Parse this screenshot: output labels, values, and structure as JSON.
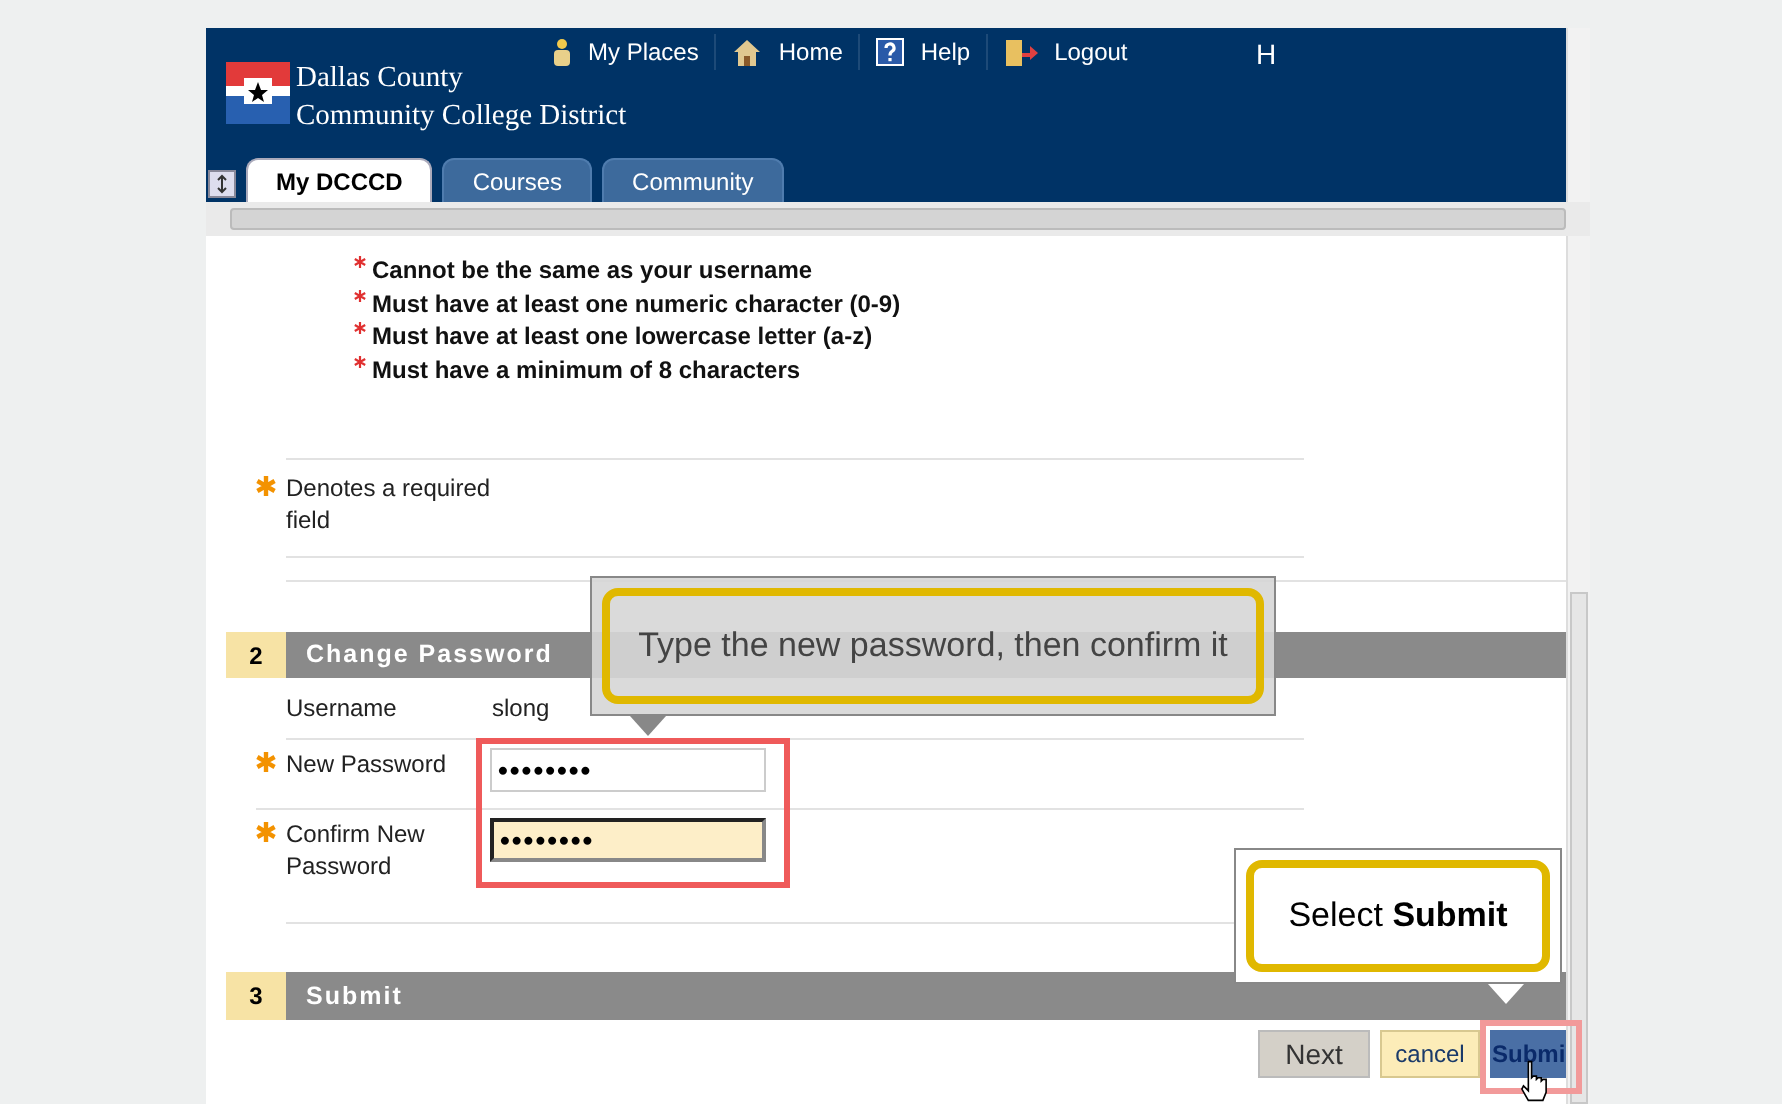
{
  "header": {
    "logo_lines": [
      "Dallas County",
      "Community College District"
    ],
    "nav": [
      {
        "label": "My Places",
        "kind": "places"
      },
      {
        "label": "Home",
        "kind": "home"
      },
      {
        "label": "Help",
        "kind": "help"
      },
      {
        "label": "Logout",
        "kind": "logout"
      }
    ],
    "user_initial": "H"
  },
  "tabs": [
    {
      "label": "My DCCCD",
      "selected": true
    },
    {
      "label": "Courses",
      "selected": false
    },
    {
      "label": "Community",
      "selected": false
    }
  ],
  "requirements": [
    "Cannot be the same as your username",
    "Must have at least one numeric character (0-9)",
    "Must have at least one lowercase letter (a-z)",
    "Must have a minimum of 8 characters"
  ],
  "required_note": "Denotes a required field",
  "change_password": {
    "number": "2",
    "title": "Change Password",
    "username_label": "Username",
    "username_value": "slong",
    "fields": [
      {
        "label": "New Password",
        "value": "••••••••",
        "focused": false
      },
      {
        "label": "Confirm New Password",
        "value": "••••••••",
        "focused": true
      }
    ]
  },
  "submit_section": {
    "number": "3",
    "title": "Submit"
  },
  "buttons": [
    {
      "label": "Next",
      "kind": "next"
    },
    {
      "label": "cancel",
      "kind": "cancel"
    },
    {
      "label": "Submi",
      "kind": "submit"
    }
  ],
  "callouts": [
    {
      "text": "Type the new password, then confirm it",
      "kind": "fields"
    },
    {
      "text": "Select **Submit**",
      "kind": "submit"
    }
  ]
}
